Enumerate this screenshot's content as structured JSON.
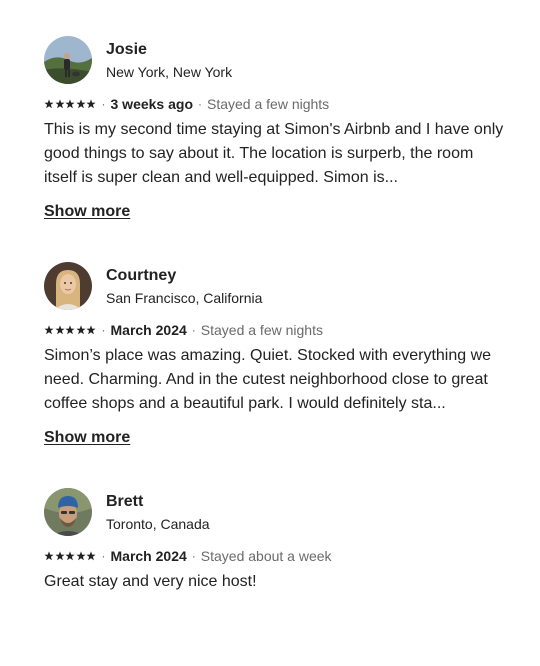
{
  "reviews": [
    {
      "name": "Josie",
      "location": "New York, New York",
      "rating": 5,
      "date": "3 weeks ago",
      "stay_length": "Stayed a few nights",
      "text": "This is my second time staying at Simon's Airbnb and I have only good things to say about it. The location is surperb, the room itself is super clean and well-equipped. Simon is...",
      "show_more": "Show more",
      "avatar_colors": [
        "#8aa4c2",
        "#4c6a3c",
        "#2d2d2d"
      ]
    },
    {
      "name": "Courtney",
      "location": "San Francisco, California",
      "rating": 5,
      "date": "March 2024",
      "stay_length": "Stayed a few nights",
      "text": "Simon’s place was amazing. Quiet. Stocked with everything we need. Charming. And in the cutest neighborhood close to great coffee shops and a beautiful park. I would definitely sta...",
      "show_more": "Show more",
      "avatar_colors": [
        "#5a4638",
        "#d9b98a",
        "#e8c9a8"
      ]
    },
    {
      "name": "Brett",
      "location": "Toronto, Canada",
      "rating": 5,
      "date": "March 2024",
      "stay_length": "Stayed about a week",
      "text": "Great stay and very nice host!",
      "avatar_colors": [
        "#3f6fa8",
        "#caa283",
        "#6b6b6b"
      ]
    }
  ],
  "separator": "·",
  "colors": {
    "text_primary": "#222222",
    "text_secondary": "#6a6a6a",
    "star": "#222222"
  }
}
